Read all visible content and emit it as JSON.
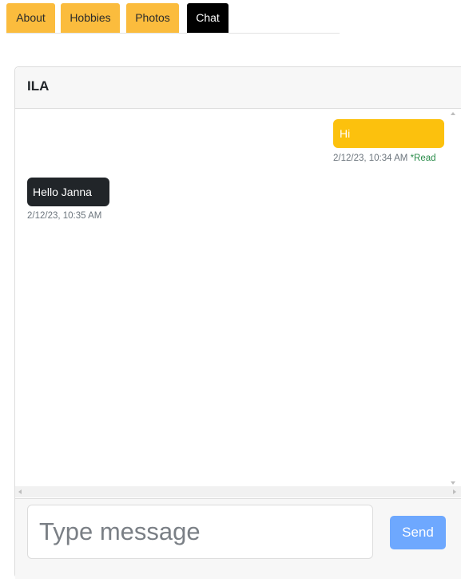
{
  "tabs": [
    {
      "label": "About",
      "active": false
    },
    {
      "label": "Hobbies",
      "active": false
    },
    {
      "label": "Photos",
      "active": false
    },
    {
      "label": "Chat",
      "active": true
    }
  ],
  "chat": {
    "contact_name": "ILA",
    "messages": [
      {
        "direction": "outgoing",
        "text": "Hi",
        "timestamp": "2/12/23, 10:34 AM",
        "status": "*Read"
      },
      {
        "direction": "incoming",
        "text": "Hello Janna",
        "timestamp": "2/12/23, 10:35 AM"
      }
    ],
    "input": {
      "value": "",
      "placeholder": "Type message"
    },
    "send_label": "Send"
  },
  "colors": {
    "tab_inactive": "#fbbc3d",
    "tab_active": "#000000",
    "outgoing_bubble": "#fcc10d",
    "incoming_bubble": "#212529",
    "read_status": "#2a8c4a",
    "send_button": "#6ea8fe"
  },
  "icons": [
    "scroll-up-arrow-icon",
    "scroll-down-arrow-icon",
    "scroll-left-arrow-icon",
    "scroll-right-arrow-icon"
  ]
}
